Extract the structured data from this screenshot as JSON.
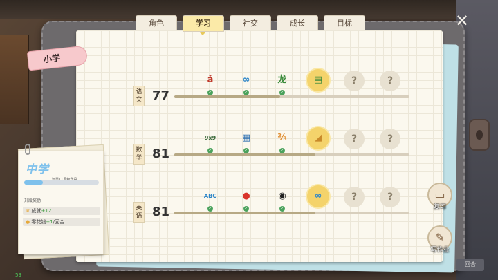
{
  "tabs": [
    {
      "label": "角色",
      "active": false
    },
    {
      "label": "学习",
      "active": true
    },
    {
      "label": "社交",
      "active": false
    },
    {
      "label": "成长",
      "active": false
    },
    {
      "label": "目标",
      "active": false
    }
  ],
  "school_level": "小学",
  "subjects": [
    {
      "name": "语\n文",
      "score": "77",
      "progress": 0.45,
      "nodes": [
        {
          "icon": "pinyin-icon",
          "glyph": "ǎ",
          "state": "done",
          "color": "#c0392b"
        },
        {
          "icon": "chain-icon",
          "glyph": "∞",
          "state": "done",
          "color": "#2d86c9"
        },
        {
          "icon": "dragon-icon",
          "glyph": "龙",
          "state": "done",
          "color": "#3a8a3a"
        },
        {
          "icon": "notebook-icon",
          "glyph": "▤",
          "state": "current",
          "color": "#3a8a3a"
        },
        {
          "icon": "question-icon",
          "glyph": "?",
          "state": "locked",
          "color": "#8a7f6a"
        },
        {
          "icon": "question-icon",
          "glyph": "?",
          "state": "locked",
          "color": "#8a7f6a"
        }
      ]
    },
    {
      "name": "数\n学",
      "score": "81",
      "progress": 0.6,
      "nodes": [
        {
          "icon": "chalkboard-icon",
          "glyph": "9x9",
          "state": "done",
          "color": "#3d6b3d"
        },
        {
          "icon": "calculator-icon",
          "glyph": "▦",
          "state": "done",
          "color": "#2d6fb0"
        },
        {
          "icon": "fraction-icon",
          "glyph": "⅔",
          "state": "done",
          "color": "#e08a2a"
        },
        {
          "icon": "ruler-icon",
          "glyph": "◢",
          "state": "current",
          "color": "#c98a2a"
        },
        {
          "icon": "question-icon",
          "glyph": "?",
          "state": "locked",
          "color": "#8a7f6a"
        },
        {
          "icon": "question-icon",
          "glyph": "?",
          "state": "locked",
          "color": "#8a7f6a"
        }
      ]
    },
    {
      "name": "英\n语",
      "score": "81",
      "progress": 0.6,
      "nodes": [
        {
          "icon": "abc-icon",
          "glyph": "ABC",
          "state": "done",
          "color": "#2d86c9"
        },
        {
          "icon": "apple-icon",
          "glyph": "●",
          "state": "done",
          "color": "#d9342b"
        },
        {
          "icon": "panda-icon",
          "glyph": "◉",
          "state": "done",
          "color": "#222222"
        },
        {
          "icon": "chain-icon",
          "glyph": "∞",
          "state": "current",
          "color": "#2d86c9"
        },
        {
          "icon": "question-icon",
          "glyph": "?",
          "state": "locked",
          "color": "#8a7f6a"
        },
        {
          "icon": "question-icon",
          "glyph": "?",
          "state": "locked",
          "color": "#8a7f6a"
        }
      ]
    }
  ],
  "side_buttons": {
    "review": "复习",
    "homework": "写作业"
  },
  "note": {
    "title": "中学",
    "hint": "还需11周级升段",
    "progress": 0.25,
    "reward_title": "升段奖励",
    "rewards": [
      {
        "icon": "trophy-icon",
        "label": "成就",
        "amount": "+12",
        "suffix": ""
      },
      {
        "icon": "coin-icon",
        "label": "零花钱",
        "amount": "+1",
        "suffix": "/回合"
      }
    ]
  },
  "fps": "59"
}
